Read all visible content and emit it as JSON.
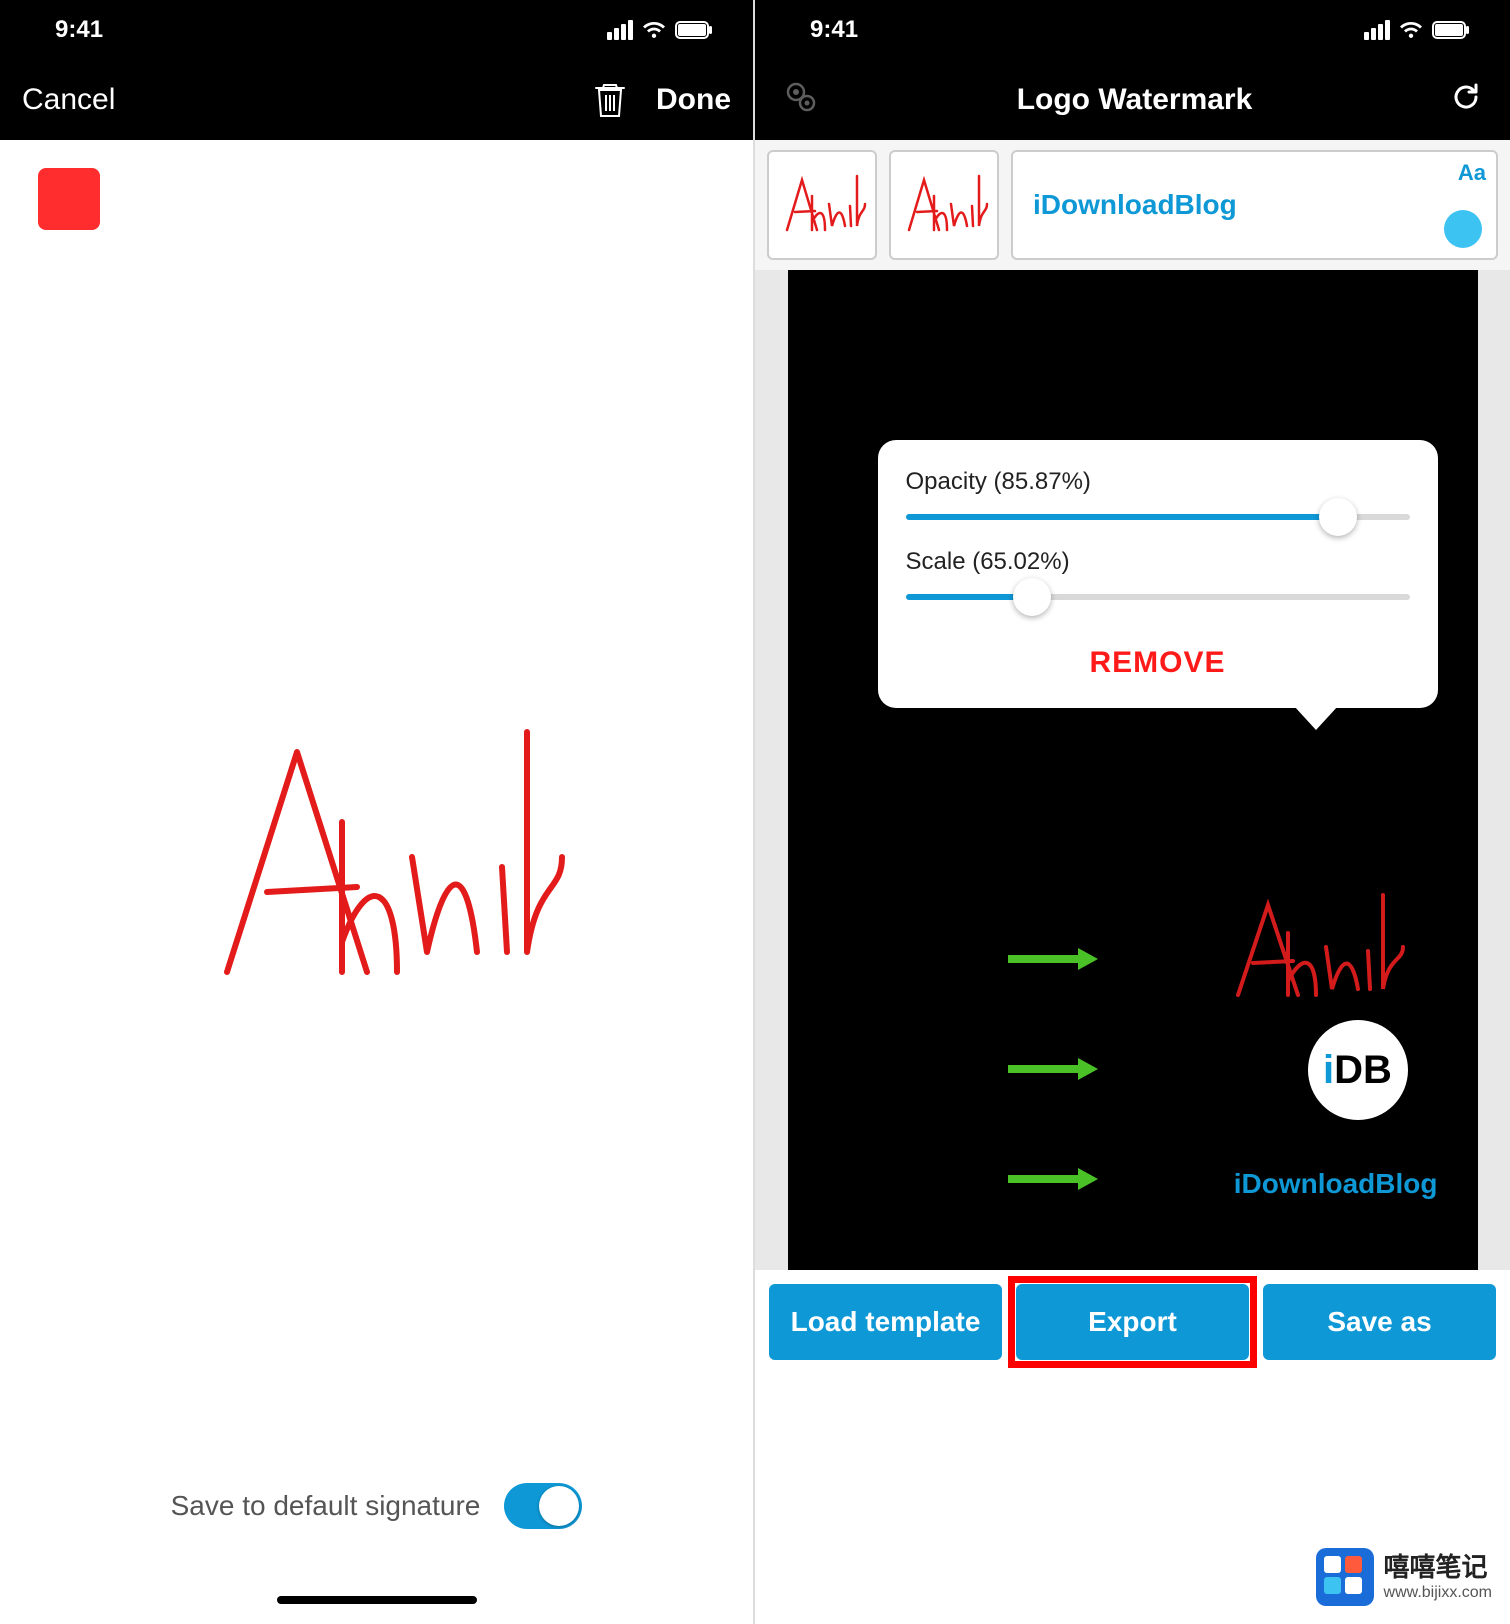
{
  "status": {
    "time": "9:41"
  },
  "left": {
    "nav": {
      "cancel": "Cancel",
      "done": "Done"
    },
    "color": "#ff2d2d",
    "signature_text": "Ankur",
    "save_label": "Save to default signature",
    "toggle_on": true
  },
  "right": {
    "nav": {
      "title": "Logo Watermark"
    },
    "watermarks": {
      "thumb1": "Ankur",
      "thumb2": "Ankur",
      "text": "iDownloadBlog",
      "aa": "Aa"
    },
    "popover": {
      "opacity_label": "Opacity (85.87%)",
      "opacity_value": 85.87,
      "scale_label": "Scale (65.02%)",
      "scale_value": 65.02,
      "remove": "REMOVE"
    },
    "overlay": {
      "signature": "Ankur",
      "idb_i": "i",
      "idb_db": "DB",
      "text": "iDownloadBlog"
    },
    "buttons": {
      "load": "Load template",
      "export": "Export",
      "save_as": "Save as"
    }
  },
  "site_watermark": {
    "cn": "嘻嘻笔记",
    "url": "www.bijixx.com"
  }
}
